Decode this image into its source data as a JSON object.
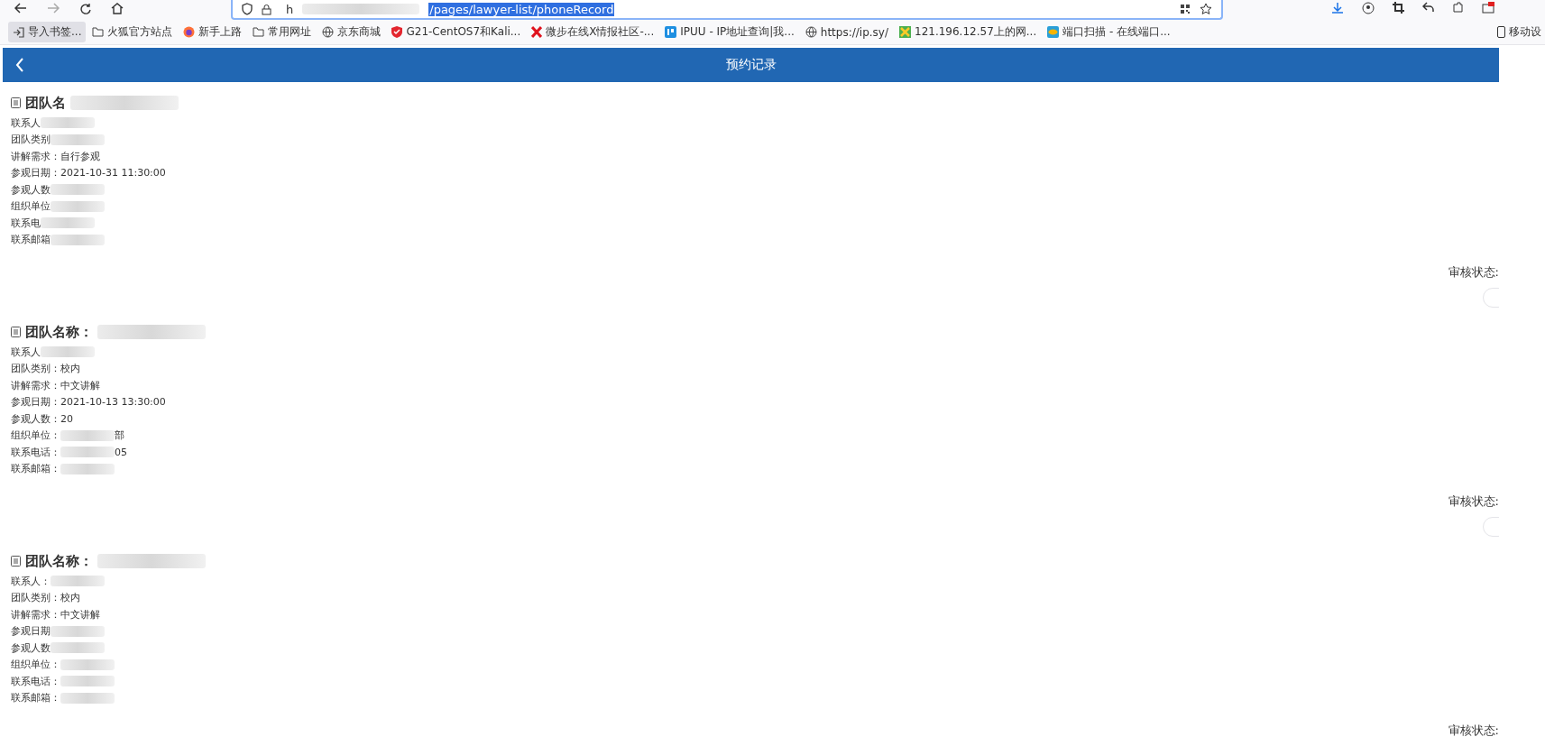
{
  "browser": {
    "address": {
      "value": "h",
      "highlighted": "/pages/lawyer-list/phoneRecord",
      "redacted": true
    },
    "bookmarks": [
      {
        "kind": "import",
        "label": "导入书签...",
        "selected": true
      },
      {
        "kind": "folder",
        "label": "火狐官方站点",
        "selected": false
      },
      {
        "kind": "firefox",
        "label": "新手上路",
        "selected": false
      },
      {
        "kind": "folder",
        "label": "常用网址",
        "selected": false
      },
      {
        "kind": "globe",
        "label": "京东商城",
        "selected": false
      },
      {
        "kind": "shield",
        "label": "G21-CentOS7和Kali...",
        "selected": false
      },
      {
        "kind": "x",
        "label": "微步在线X情报社区-...",
        "selected": false
      },
      {
        "kind": "ip",
        "label": "IPUU - IP地址查询|我...",
        "selected": false
      },
      {
        "kind": "globe",
        "label": "https://ip.sy/",
        "selected": false
      },
      {
        "kind": "tool",
        "label": "121.196.12.57上的网...",
        "selected": false
      },
      {
        "kind": "port",
        "label": "端口扫描 - 在线端口...",
        "selected": false
      }
    ],
    "mobile_label": "移动设"
  },
  "header": {
    "title": "预约记录"
  },
  "records": [
    {
      "title": {
        "label": "团队名",
        "redacted": true
      },
      "fields": [
        {
          "label": "联系人",
          "redacted": true
        },
        {
          "label": "团队类别",
          "redacted": true
        },
        {
          "label": "讲解需求：",
          "value": "自行参观",
          "redacted": false
        },
        {
          "label": "参观日期：",
          "value": "2021-10-31 11:30:00",
          "redacted": false
        },
        {
          "label": "参观人数",
          "redacted": true
        },
        {
          "label": "组织单位",
          "redacted": true
        },
        {
          "label": "联系电",
          "redacted": true
        },
        {
          "label": "联系邮箱",
          "redacted": true
        }
      ],
      "status_label": "审核状态:",
      "action_button": true
    },
    {
      "title": {
        "label": "团队名称：",
        "redacted": true
      },
      "fields": [
        {
          "label": "联系人",
          "redacted": true
        },
        {
          "label": "团队类别：",
          "value": "校内",
          "redacted": false
        },
        {
          "label": "讲解需求：",
          "value": "中文讲解",
          "redacted": false
        },
        {
          "label": "参观日期：",
          "value": "2021-10-13 13:30:00",
          "redacted": false
        },
        {
          "label": "参观人数：",
          "value": "20",
          "redacted": false
        },
        {
          "label": "组织单位：",
          "redacted": true,
          "tail": "部"
        },
        {
          "label": "联系电话：",
          "redacted": true,
          "tail": "05"
        },
        {
          "label": "联系邮箱：",
          "redacted": true
        }
      ],
      "status_label": "审核状态:",
      "action_button": true
    },
    {
      "title": {
        "label": "团队名称：",
        "redacted": true
      },
      "fields": [
        {
          "label": "联系人：",
          "redacted": true
        },
        {
          "label": "团队类别：",
          "value": "校内",
          "redacted": false
        },
        {
          "label": "讲解需求：",
          "value": "中文讲解",
          "redacted": false
        },
        {
          "label": "参观日期",
          "redacted": true
        },
        {
          "label": "参观人数",
          "redacted": true
        },
        {
          "label": "组织单位：",
          "redacted": true
        },
        {
          "label": "联系电话：",
          "redacted": true
        },
        {
          "label": "联系邮箱：",
          "redacted": true
        }
      ],
      "status_label": "审核状态:"
    }
  ]
}
